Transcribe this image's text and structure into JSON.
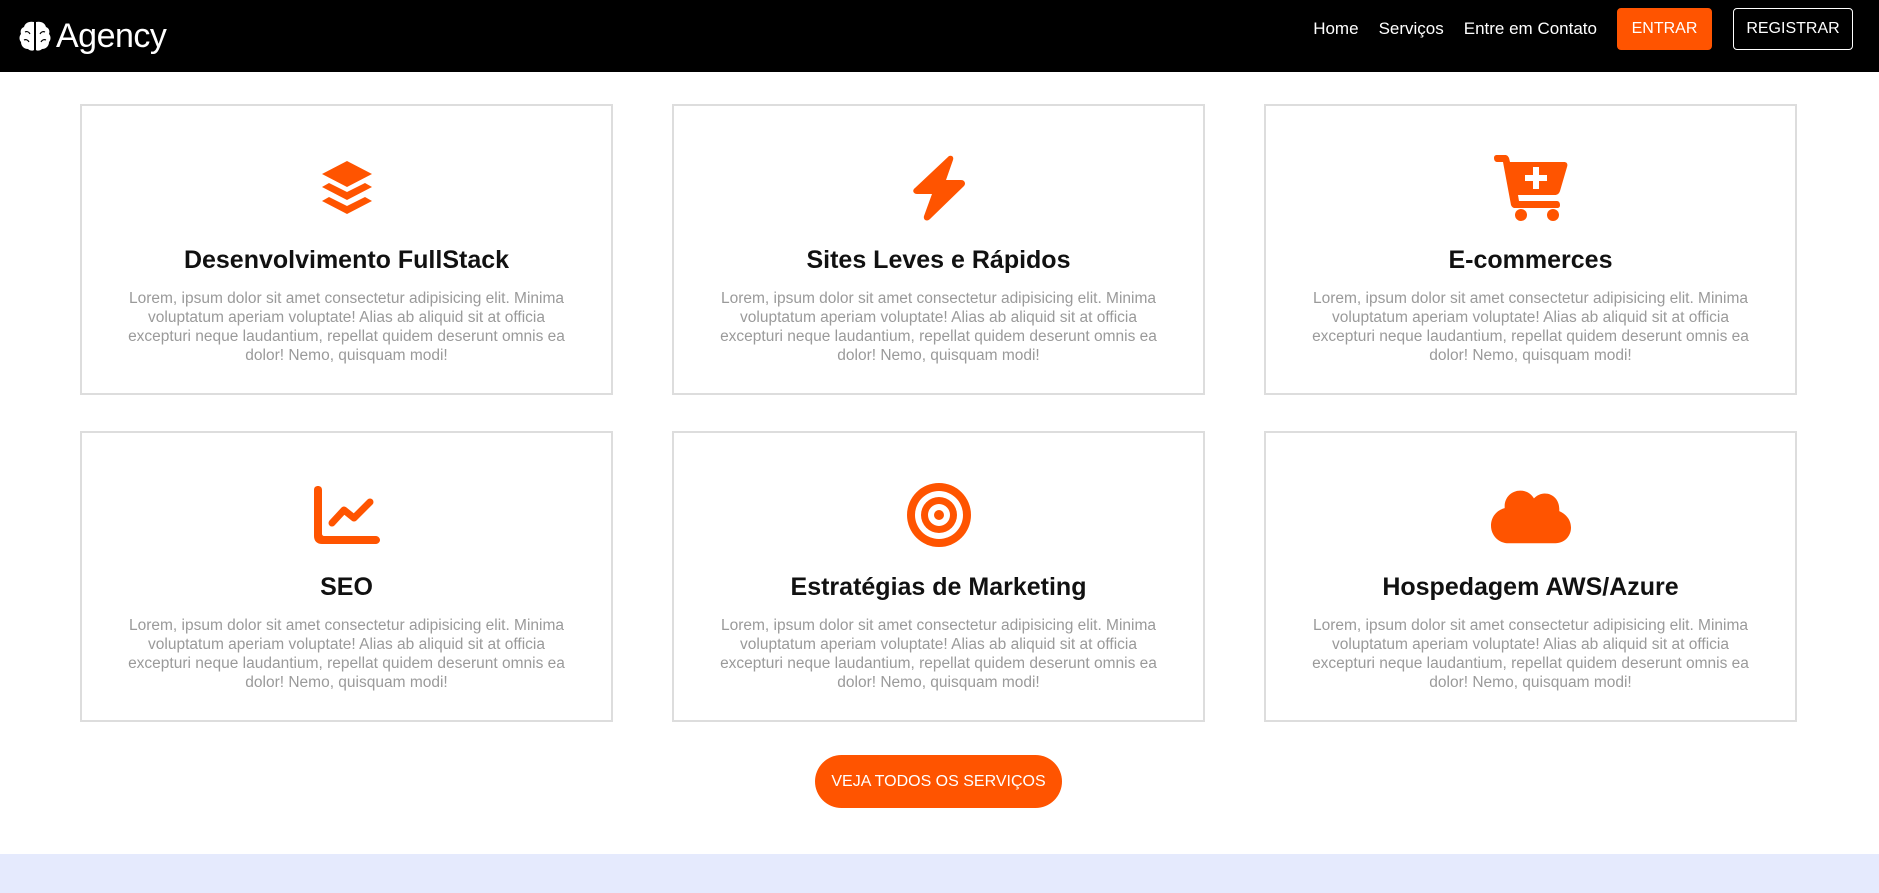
{
  "colors": {
    "accent": "#ff5400",
    "navbar_bg": "#000000",
    "card_border": "#dddddd",
    "text_muted": "#9a9a9a",
    "footer_band": "#e5eafd"
  },
  "header": {
    "brand_icon": "brain-icon",
    "brand_name": "Agency",
    "nav": [
      "Home",
      "Serviços",
      "Entre em Contato"
    ],
    "login_button": "ENTRAR",
    "register_button": "REGISTRAR"
  },
  "services": [
    {
      "icon": "layers-icon",
      "title": "Desenvolvimento FullStack",
      "text": "Lorem, ipsum dolor sit amet consectetur adipisicing elit. Minima voluptatum aperiam voluptate! Alias ab aliquid sit at officia excepturi neque laudantium, repellat quidem deserunt omnis ea dolor! Nemo, quisquam modi!"
    },
    {
      "icon": "lightning-bolt-icon",
      "title": "Sites Leves e Rápidos",
      "text": "Lorem, ipsum dolor sit amet consectetur adipisicing elit. Minima voluptatum aperiam voluptate! Alias ab aliquid sit at officia excepturi neque laudantium, repellat quidem deserunt omnis ea dolor! Nemo, quisquam modi!"
    },
    {
      "icon": "cart-plus-icon",
      "title": "E-commerces",
      "text": "Lorem, ipsum dolor sit amet consectetur adipisicing elit. Minima voluptatum aperiam voluptate! Alias ab aliquid sit at officia excepturi neque laudantium, repellat quidem deserunt omnis ea dolor! Nemo, quisquam modi!"
    },
    {
      "icon": "line-chart-icon",
      "title": "SEO",
      "text": "Lorem, ipsum dolor sit amet consectetur adipisicing elit. Minima voluptatum aperiam voluptate! Alias ab aliquid sit at officia excepturi neque laudantium, repellat quidem deserunt omnis ea dolor! Nemo, quisquam modi!"
    },
    {
      "icon": "target-icon",
      "title": "Estratégias de Marketing",
      "text": "Lorem, ipsum dolor sit amet consectetur adipisicing elit. Minima voluptatum aperiam voluptate! Alias ab aliquid sit at officia excepturi neque laudantium, repellat quidem deserunt omnis ea dolor! Nemo, quisquam modi!"
    },
    {
      "icon": "cloud-icon",
      "title": "Hospedagem AWS/Azure",
      "text": "Lorem, ipsum dolor sit amet consectetur adipisicing elit. Minima voluptatum aperiam voluptate! Alias ab aliquid sit at officia excepturi neque laudantium, repellat quidem deserunt omnis ea dolor! Nemo, quisquam modi!"
    }
  ],
  "cta_button": "VEJA TODOS OS SERVIÇOS"
}
